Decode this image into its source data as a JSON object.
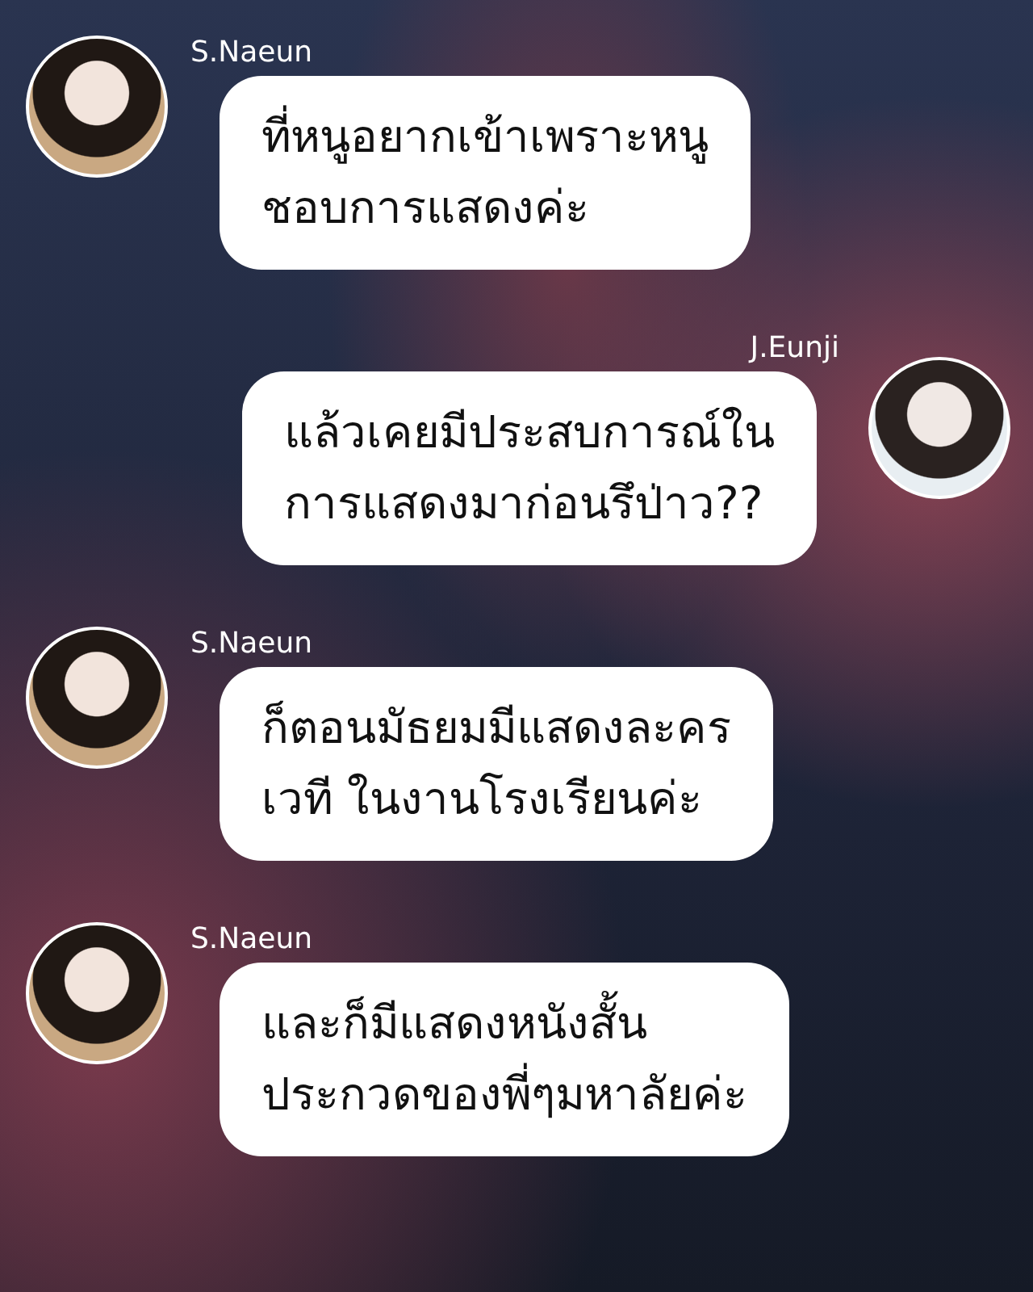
{
  "messages": [
    {
      "kind": "incoming",
      "sender": "S.Naeun",
      "text": "ที่หนูอยากเข้าเพราะหนู\nชอบการแสดงค่ะ"
    },
    {
      "kind": "outgoing",
      "sender": "J.Eunji",
      "text": "แล้วเคยมีประสบการณ์ใน\nการแสดงมาก่อนรึป่าว??"
    },
    {
      "kind": "incoming",
      "sender": "S.Naeun",
      "text": "ก็ตอนมัธยมมีแสดงละคร\nเวที ในงานโรงเรียนค่ะ"
    },
    {
      "kind": "incoming",
      "sender": "S.Naeun",
      "text": "และก็มีแสดงหนังสั้น\nประกวดของพี่ๆมหาลัยค่ะ"
    }
  ]
}
